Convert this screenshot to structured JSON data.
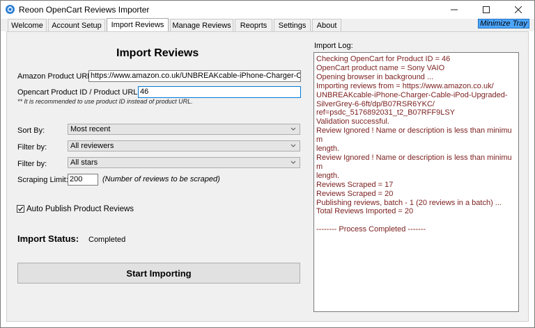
{
  "window": {
    "title": "Reoon OpenCart Reviews Importer",
    "minimize_glyph": "—",
    "maximize_glyph": "☐",
    "close_glyph": "✕"
  },
  "tabs": [
    {
      "label": "Welcome"
    },
    {
      "label": "Account Setup"
    },
    {
      "label": "Import Reviews",
      "active": true
    },
    {
      "label": "Manage Reviews"
    },
    {
      "label": "Reoprts"
    },
    {
      "label": "Settings"
    },
    {
      "label": "About"
    }
  ],
  "minimize_tray_label": "Minimize Tray",
  "form": {
    "heading": "Import Reviews",
    "amazon_url_label": "Amazon Product URL:",
    "amazon_url_value": "https://www.amazon.co.uk/UNBREAKcable-iPhone-Charger-Cable-iPod-Upgraded-SilverGrey-6-6ft/dp/B07RSR6YKC/",
    "product_id_label": "Opencart Product ID / Product URL:",
    "product_id_value": "46",
    "note": "** It is recommended to use product ID instead of product URL.",
    "sort_label": "Sort By:",
    "sort_value": "Most recent",
    "filter1_label": "Filter by:",
    "filter1_value": "All reviewers",
    "filter2_label": "Filter by:",
    "filter2_value": "All stars",
    "limit_label": "Scraping Limit:",
    "limit_value": "200",
    "limit_hint": "(Number of reviews to be scraped)",
    "auto_publish_label": "Auto Publish Product Reviews",
    "auto_publish_checked": true,
    "status_label": "Import Status:",
    "status_value": "Completed",
    "start_button": "Start Importing"
  },
  "log": {
    "label": "Import Log:",
    "lines": [
      "Checking OpenCart for Product ID = 46",
      "OpenCart product name = Sony VAIO",
      "Opening browser in background ...",
      "Importing reviews from = https://www.amazon.co.uk/",
      "UNBREAKcable-iPhone-Charger-Cable-iPod-Upgraded-",
      "SilverGrey-6-6ft/dp/B07RSR6YKC/",
      "ref=psdc_5176892031_t2_B07RFF9LSY",
      "Validation successful.",
      "Review Ignored ! Name or description is less than minimum",
      "length.",
      "Review Ignored ! Name or description is less than minimum",
      "length.",
      "Reviews Scraped = 17",
      "Reviews Scraped = 20",
      "Publishing reviews, batch - 1 (20 reviews in a batch) ...",
      "Total Reviews Imported = 20",
      "",
      "-------- Process Completed -------"
    ]
  },
  "colors": {
    "accent": "#0078d7",
    "log_text": "#7b1d1d",
    "tray_button": "#4da6ff"
  }
}
